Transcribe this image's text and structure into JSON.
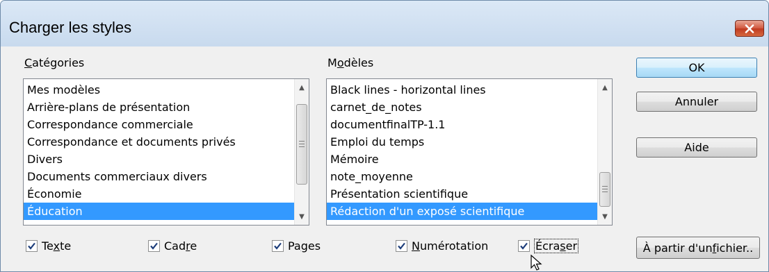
{
  "window": {
    "title": "Charger les styles"
  },
  "categories": {
    "label_accel": "C",
    "label_rest": "atégories",
    "items": [
      "Mes modèles",
      "Arrière-plans de présentation",
      "Correspondance commerciale",
      "Correspondance et documents privés",
      "Divers",
      "Documents commerciaux divers",
      "Économie",
      "Éducation"
    ],
    "selected_index": 7
  },
  "templates": {
    "label_pre": "M",
    "label_accel": "o",
    "label_rest": "dèles",
    "items": [
      "Black lines - horizontal lines",
      "carnet_de_notes",
      "documentfinalTP-1.1",
      "Emploi du temps",
      "Mémoire",
      "note_moyenne",
      "Présentation scientifique",
      "Rédaction d'un exposé scientifique"
    ],
    "selected_index": 7
  },
  "buttons": {
    "ok": "OK",
    "cancel": "Annuler",
    "help": "Aide",
    "from_file_pre": "À partir d'un ",
    "from_file_accel": "f",
    "from_file_rest": "ichier.."
  },
  "options": {
    "texte": {
      "pre": "Te",
      "accel": "x",
      "rest": "te",
      "checked": true
    },
    "cadre": {
      "pre": "Cad",
      "accel": "r",
      "rest": "e",
      "checked": true
    },
    "pages": {
      "pre": "Pa",
      "accel": "g",
      "rest": "es",
      "checked": true
    },
    "numerotation": {
      "pre": "",
      "accel": "N",
      "rest": "umérotation",
      "checked": true
    },
    "ecraser": {
      "pre": "Écra",
      "accel": "s",
      "rest": "er",
      "checked": true
    }
  },
  "colors": {
    "selection": "#3399ff",
    "close_button": "#c8432a",
    "titlebar": "#cddff2"
  }
}
